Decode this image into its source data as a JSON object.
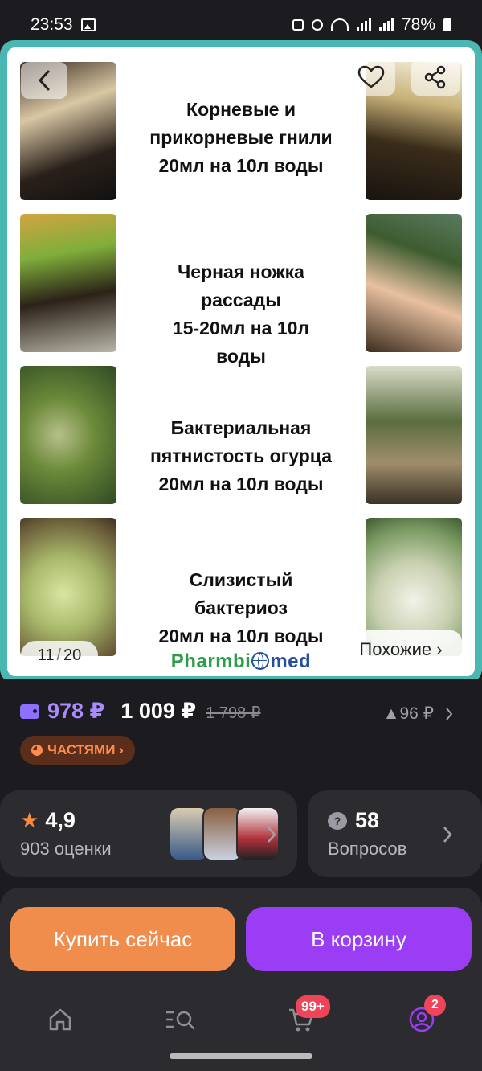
{
  "status_bar": {
    "time": "23:53",
    "battery": "78%"
  },
  "gallery": {
    "diseases": [
      {
        "lines": [
          "Корневые и",
          "прикорневые гнили",
          "20мл на 10л воды"
        ]
      },
      {
        "lines": [
          "Черная ножка",
          "рассады",
          "15-20мл на 10л",
          "воды"
        ]
      },
      {
        "lines": [
          "Бактериальная",
          "пятнистость огурца",
          "20мл на 10л воды"
        ]
      },
      {
        "lines": [
          "Слизистый",
          "бактериоз",
          "20мл на 10л воды"
        ]
      }
    ],
    "counter_current": "11",
    "counter_total": "20",
    "similar_label": "Похожие ›",
    "brand_part1": "Pharmbi",
    "brand_part2": "med"
  },
  "price": {
    "wallet_price": "978 ₽",
    "current_price": "1 009 ₽",
    "old_price": "1 798 ₽",
    "delta": "▲96 ₽",
    "parts_label": "ЧАСТЯМИ ›"
  },
  "rating": {
    "value": "4,9",
    "count_label": "903 оценки"
  },
  "questions": {
    "count": "58",
    "label": "Вопросов"
  },
  "actions": {
    "buy_now": "Купить сейчас",
    "add_to_cart": "В корзину"
  },
  "tabbar": {
    "cart_badge": "99+",
    "profile_badge": "2"
  },
  "colors": {
    "accent_purple": "#9b3df5",
    "accent_orange": "#f08c4c",
    "frame_teal": "#4bb7b3",
    "badge_red": "#f0445a"
  }
}
